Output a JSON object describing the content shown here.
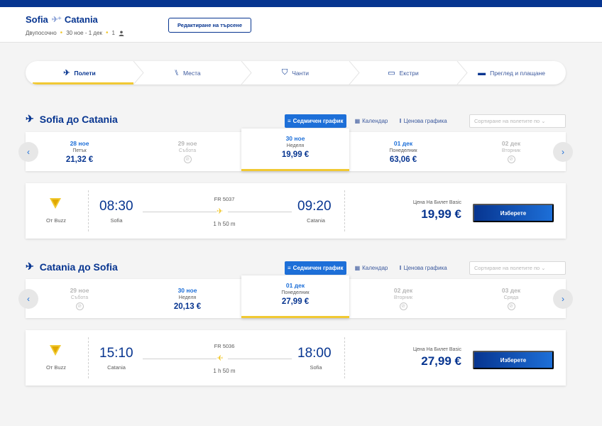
{
  "header": {
    "origin": "Sofia",
    "destination": "Catania",
    "trip_type": "Двупосочно",
    "dates": "30 ное - 1 дек",
    "passengers": "1",
    "edit_label": "Редактиране на търсене"
  },
  "steps": [
    {
      "label": "Полети",
      "icon": "plane-icon"
    },
    {
      "label": "Места",
      "icon": "seat-icon"
    },
    {
      "label": "Чанти",
      "icon": "bag-icon"
    },
    {
      "label": "Екстри",
      "icon": "monitor-icon"
    },
    {
      "label": "Преглед и плащане",
      "icon": "card-icon"
    }
  ],
  "view_tabs": {
    "weekly": "Седмичен график",
    "calendar": "Календар",
    "price_chart": "Ценова графика",
    "sort_placeholder": "Сортиране на полетите по"
  },
  "outbound": {
    "title": "Sofia до Catania",
    "dates": [
      {
        "date": "28 ное",
        "weekday": "Петък",
        "price": "21,32 €"
      },
      {
        "date": "29 ное",
        "weekday": "Събота",
        "price": ""
      },
      {
        "date": "30 ное",
        "weekday": "Неделя",
        "price": "19,99 €"
      },
      {
        "date": "01 дек",
        "weekday": "Понеделник",
        "price": "63,06 €"
      },
      {
        "date": "02 дек",
        "weekday": "Вторник",
        "price": ""
      }
    ],
    "flight": {
      "operator": "От Buzz",
      "depart_time": "08:30",
      "depart_city": "Sofia",
      "flight_no": "FR 5037",
      "duration": "1 h 50 m",
      "arrive_time": "09:20",
      "arrive_city": "Catania",
      "fare_label": "Цена На Билет Basic",
      "price": "19,99 €",
      "select_label": "Изберете"
    }
  },
  "inbound": {
    "title": "Catania до Sofia",
    "dates": [
      {
        "date": "29 ное",
        "weekday": "Събота",
        "price": ""
      },
      {
        "date": "30 ное",
        "weekday": "Неделя",
        "price": "20,13 €"
      },
      {
        "date": "01 дек",
        "weekday": "Понеделник",
        "price": "27,99 €"
      },
      {
        "date": "02 дек",
        "weekday": "Вторник",
        "price": ""
      },
      {
        "date": "03 дек",
        "weekday": "Сряда",
        "price": ""
      }
    ],
    "flight": {
      "operator": "От Buzz",
      "depart_time": "15:10",
      "depart_city": "Catania",
      "flight_no": "FR 5036",
      "duration": "1 h 50 m",
      "arrive_time": "18:00",
      "arrive_city": "Sofia",
      "fare_label": "Цена На Билет Basic",
      "price": "27,99 €",
      "select_label": "Изберете"
    }
  },
  "colors": {
    "brand": "#073590",
    "accent": "#f1c933",
    "link": "#1d6fd8"
  }
}
